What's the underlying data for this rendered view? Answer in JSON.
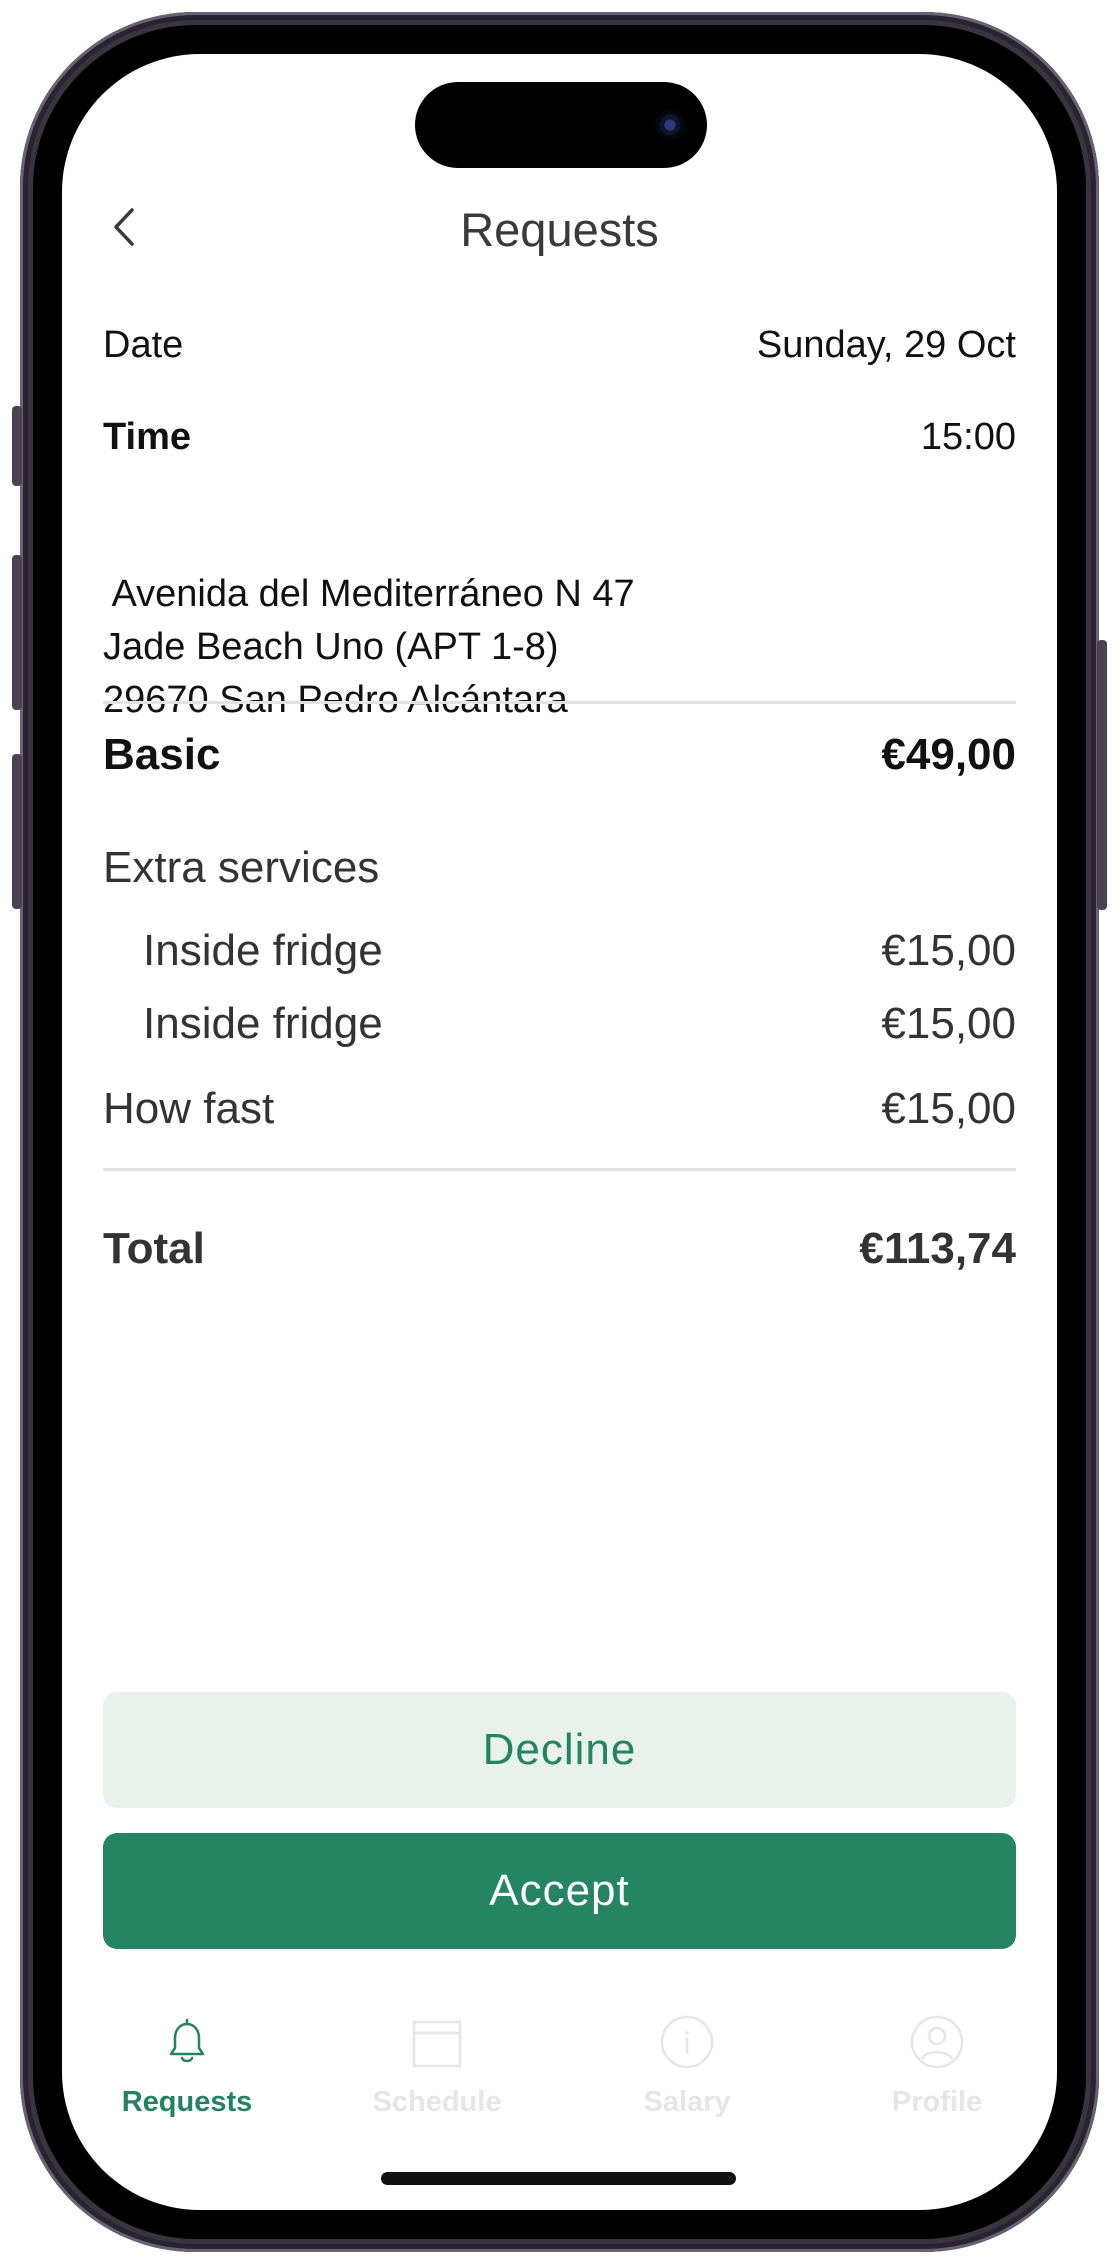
{
  "header": {
    "title": "Requests"
  },
  "details": {
    "date_label": "Date",
    "date_value": "Sunday, 29 Oct",
    "time_label": "Time",
    "time_value": "15:00",
    "address_line1": " Avenida del Mediterráneo N 47",
    "address_line2": "Jade Beach Uno (APT 1-8)",
    "address_line3": "29670 San Pedro Alcántara"
  },
  "pricing": {
    "basic_label": "Basic",
    "basic_value": "€49,00",
    "extra_label": "Extra services",
    "extras": [
      {
        "label": "Inside fridge",
        "value": "€15,00"
      },
      {
        "label": "Inside fridge",
        "value": "€15,00"
      }
    ],
    "fast_label": "How fast",
    "fast_value": "€15,00",
    "total_label": "Total",
    "total_value": "€113,74"
  },
  "actions": {
    "decline_label": "Decline",
    "accept_label": "Accept"
  },
  "tabs": [
    {
      "label": "Requests",
      "icon": "bell-icon",
      "active": true
    },
    {
      "label": "Schedule",
      "icon": "calendar-icon",
      "active": false
    },
    {
      "label": "Salary",
      "icon": "info-icon",
      "active": false
    },
    {
      "label": "Profile",
      "icon": "person-icon",
      "active": false
    }
  ],
  "colors": {
    "accent": "#258563",
    "decline_bg": "#e9f1ed",
    "inactive_tab": "#e6e6e8"
  }
}
